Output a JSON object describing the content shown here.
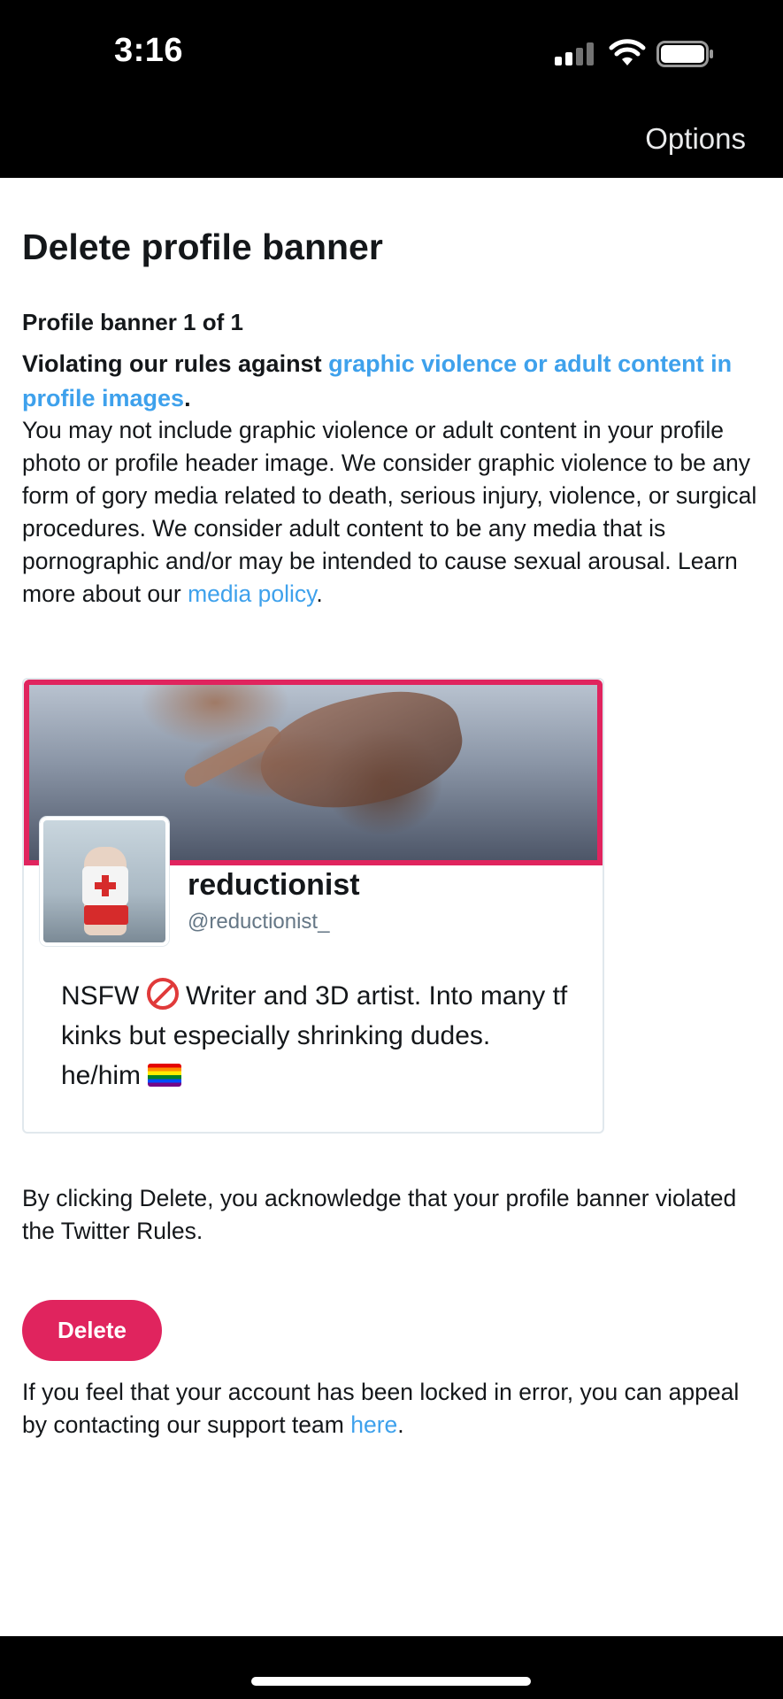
{
  "status_bar": {
    "time": "3:16",
    "icons": [
      "signal-icon",
      "wifi-icon",
      "battery-icon"
    ]
  },
  "nav": {
    "options_label": "Options"
  },
  "page": {
    "title": "Delete profile banner",
    "banner_count": "Profile banner 1 of 1",
    "violation_prefix": "Violating our rules against ",
    "violation_link": "graphic violence or adult content in profile images",
    "violation_suffix": ".",
    "policy_text": "You may not include graphic violence or adult content in your profile photo or profile header image. We consider graphic violence to be any form of gory media related to death, serious injury, violence, or surgical procedures. We consider adult content to be any media that is pornographic and/or may be intended to cause sexual arousal. Learn more about our ",
    "policy_link": "media policy",
    "policy_suffix": "."
  },
  "profile_card": {
    "display_name": "reductionist",
    "handle": "@reductionist_",
    "bio_part1": "NSFW ",
    "bio_part2": " Writer and 3D artist. Into many tf kinks but especially shrinking dudes. he/him ",
    "bio_emojis": [
      "no-one-under-eighteen-emoji",
      "rainbow-flag-emoji"
    ],
    "banner_highlight_color": "#e0245e"
  },
  "acknowledgement": {
    "text": "By clicking Delete, you acknowledge that your profile banner violated the Twitter Rules."
  },
  "actions": {
    "delete_label": "Delete",
    "delete_color": "#e0245e"
  },
  "appeal": {
    "text": "If you feel that your account has been locked in error, you can appeal by contacting our support team ",
    "link": "here",
    "suffix": "."
  },
  "colors": {
    "link": "#3ea1ec",
    "text": "#14171a",
    "handle": "#657786"
  }
}
